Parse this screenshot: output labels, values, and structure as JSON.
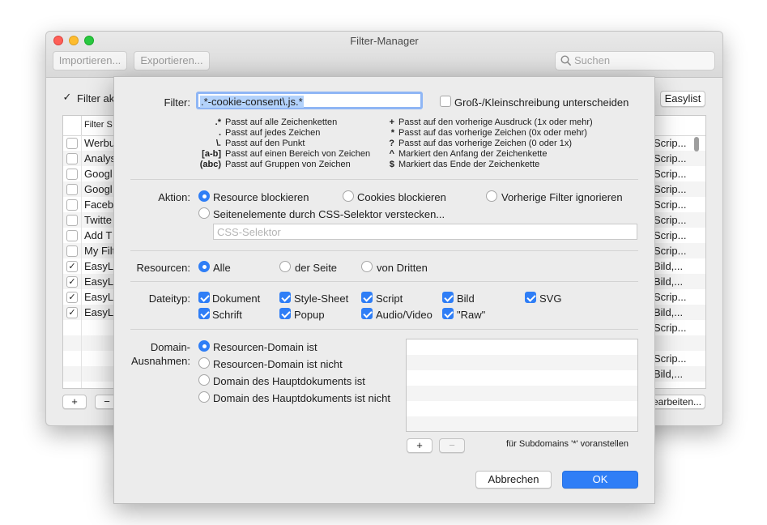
{
  "window": {
    "title": "Filter-Manager",
    "import_label": "Importieren...",
    "export_label": "Exportieren...",
    "search_placeholder": "Suchen",
    "filter_active_label": "Filter ak",
    "easylist_label": "Easylist",
    "column_header": "Filter S",
    "edit_label": "earbeiten...",
    "add_label": "+",
    "remove_label": "−",
    "rows": [
      {
        "name": "Werbu",
        "type": "Scrip...",
        "checked": false
      },
      {
        "name": "Analys",
        "type": "Scrip...",
        "checked": false
      },
      {
        "name": "Googl",
        "type": "Scrip...",
        "checked": false
      },
      {
        "name": "Googl",
        "type": "Scrip...",
        "checked": false
      },
      {
        "name": "Faceb",
        "type": "Scrip...",
        "checked": false
      },
      {
        "name": "Twitte",
        "type": "Scrip...",
        "checked": false
      },
      {
        "name": "Add T",
        "type": "Scrip...",
        "checked": false
      },
      {
        "name": "My Filt",
        "type": "Scrip...",
        "checked": false
      },
      {
        "name": "EasyLi",
        "type": "Bild,...",
        "checked": true
      },
      {
        "name": "EasyLi",
        "type": "Bild,...",
        "checked": true
      },
      {
        "name": "EasyLi",
        "type": "Scrip...",
        "checked": true
      },
      {
        "name": "EasyLi",
        "type": "Bild,...",
        "checked": true
      },
      {
        "name": "",
        "type": "Scrip...",
        "checked": null
      },
      {
        "name": "",
        "type": "",
        "checked": null
      },
      {
        "name": "",
        "type": "Scrip...",
        "checked": null
      },
      {
        "name": "",
        "type": "Bild,...",
        "checked": null
      }
    ]
  },
  "dialog": {
    "filter_label": "Filter:",
    "filter_value": ".*-cookie-consent\\.js.*",
    "case_label": "Groß-/Kleinschreibung unterscheiden",
    "help_left": [
      {
        "sym": ".*",
        "text": "Passt auf alle Zeichenketten"
      },
      {
        "sym": ".",
        "text": "Passt auf jedes Zeichen"
      },
      {
        "sym": "\\.",
        "text": "Passt auf den Punkt"
      },
      {
        "sym": "[a-b]",
        "text": "Passt auf einen Bereich von Zeichen"
      },
      {
        "sym": "(abc)",
        "text": "Passt auf Gruppen von Zeichen"
      }
    ],
    "help_right": [
      {
        "sym": "+",
        "text": "Passt auf den vorherige Ausdruck (1x oder mehr)"
      },
      {
        "sym": "*",
        "text": "Passt auf das vorherige Zeichen (0x oder mehr)"
      },
      {
        "sym": "?",
        "text": "Passt auf das vorherige Zeichen (0 oder 1x)"
      },
      {
        "sym": "^",
        "text": "Markiert den Anfang der Zeichenkette"
      },
      {
        "sym": "$",
        "text": "Markiert das Ende der Zeichenkette"
      }
    ],
    "action_label": "Aktion:",
    "actions": [
      "Resource blockieren",
      "Cookies blockieren",
      "Vorherige Filter ignorieren",
      "Seitenelemente durch CSS-Selektor verstecken..."
    ],
    "css_placeholder": "CSS-Selektor",
    "resources_label": "Resourcen:",
    "resources": [
      "Alle",
      "der Seite",
      "von Dritten"
    ],
    "filetype_label": "Dateityp:",
    "filetypes": [
      "Dokument",
      "Style-Sheet",
      "Script",
      "Bild",
      "SVG",
      "Schrift",
      "Popup",
      "Audio/Video",
      "\"Raw\""
    ],
    "domain_label_1": "Domain-",
    "domain_label_2": "Ausnahmen:",
    "domain_options": [
      "Resourcen-Domain ist",
      "Resourcen-Domain ist nicht",
      "Domain des Hauptdokuments ist",
      "Domain des Hauptdokuments ist nicht"
    ],
    "subdomain_hint": "für Subdomains '*' voranstellen",
    "add_label": "+",
    "remove_label": "−",
    "cancel_label": "Abbrechen",
    "ok_label": "OK"
  },
  "colors": {
    "accent": "#2f7ef6",
    "close": "#fe5f57",
    "minimize": "#febc2e",
    "zoom": "#28c840"
  }
}
